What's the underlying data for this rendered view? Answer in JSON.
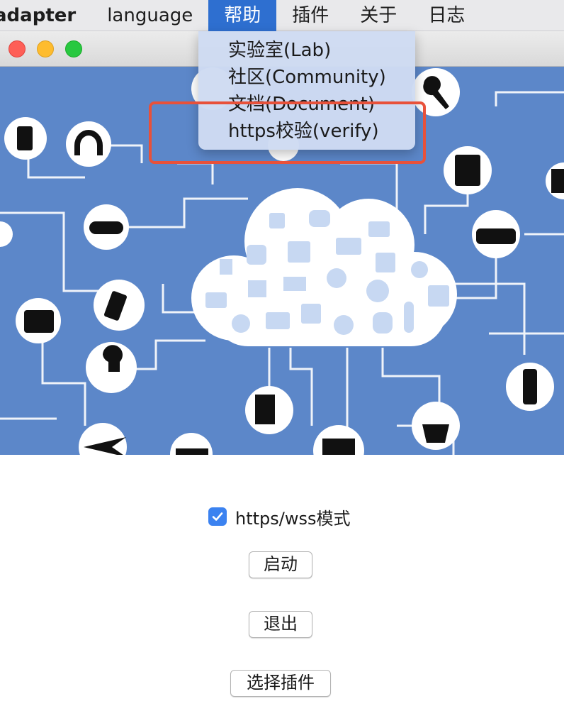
{
  "menubar": {
    "app_name": "adapter",
    "items": [
      "language",
      "帮助",
      "插件",
      "关于",
      "日志"
    ],
    "active_item": "帮助"
  },
  "help_menu": {
    "items": [
      "实验室(Lab)",
      "社区(Community)",
      "文档(Document)",
      "https校验(verify)"
    ],
    "highlighted_item": "https校验(verify)"
  },
  "controls": {
    "https_checkbox_label": "https/wss模式",
    "https_checkbox_checked": true,
    "start_button": "启动",
    "quit_button": "退出",
    "select_plugin_button": "选择插件"
  },
  "colors": {
    "illustration_bg": "#5c87c9",
    "menu_active": "#2e6fd0",
    "highlight_outline": "#e8513a",
    "checkbox": "#3b82f0"
  },
  "illustration": {
    "icons": [
      "blender-icon",
      "headphones-icon",
      "gamepad-icon",
      "phone-icon",
      "camera-icon",
      "lightbulb-icon",
      "airplane-icon",
      "truck-icon",
      "speaker-icon",
      "monitor-icon",
      "scale-icon",
      "watch-icon",
      "radio-icon",
      "washing-machine-icon",
      "microphone-icon",
      "tv-icon",
      "cloud-icon"
    ]
  }
}
